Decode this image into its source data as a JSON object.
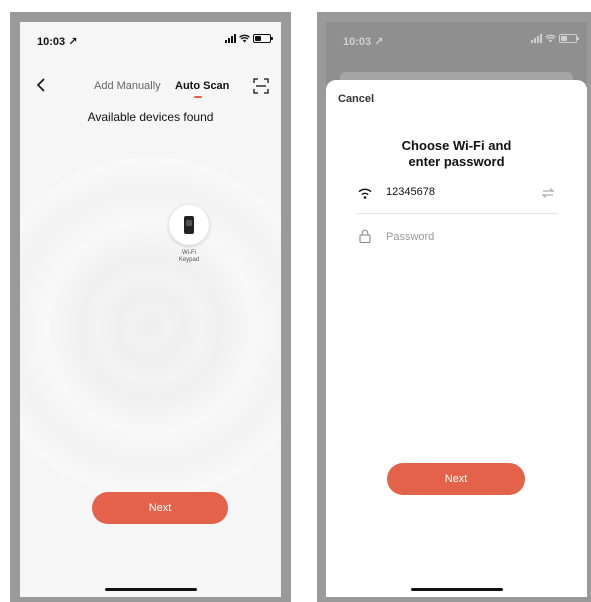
{
  "left_screen": {
    "status_time": "10:03 ↗",
    "nav": {
      "tab_add_manually": "Add Manually",
      "tab_auto_scan": "Auto Scan",
      "back_icon": "chevron-left-icon",
      "scan_icon": "qr-scan-icon"
    },
    "title": "Available devices found",
    "device": {
      "label_line1": "Wi-Fi",
      "label_line2": "Keypad",
      "icon": "keypad-icon"
    },
    "next_label": "Next"
  },
  "right_screen": {
    "status_time": "10:03 ↗",
    "cancel_label": "Cancel",
    "title_line1": "Choose Wi-Fi and",
    "title_line2": "enter password",
    "wifi": {
      "ssid": "12345678",
      "icon": "wifi-icon",
      "switch_icon": "swap-icon"
    },
    "password": {
      "placeholder": "Password",
      "icon": "lock-icon"
    },
    "next_label": "Next"
  },
  "colors": {
    "accent": "#e5624a",
    "frame": "#9a9a9a",
    "text": "#111111"
  }
}
